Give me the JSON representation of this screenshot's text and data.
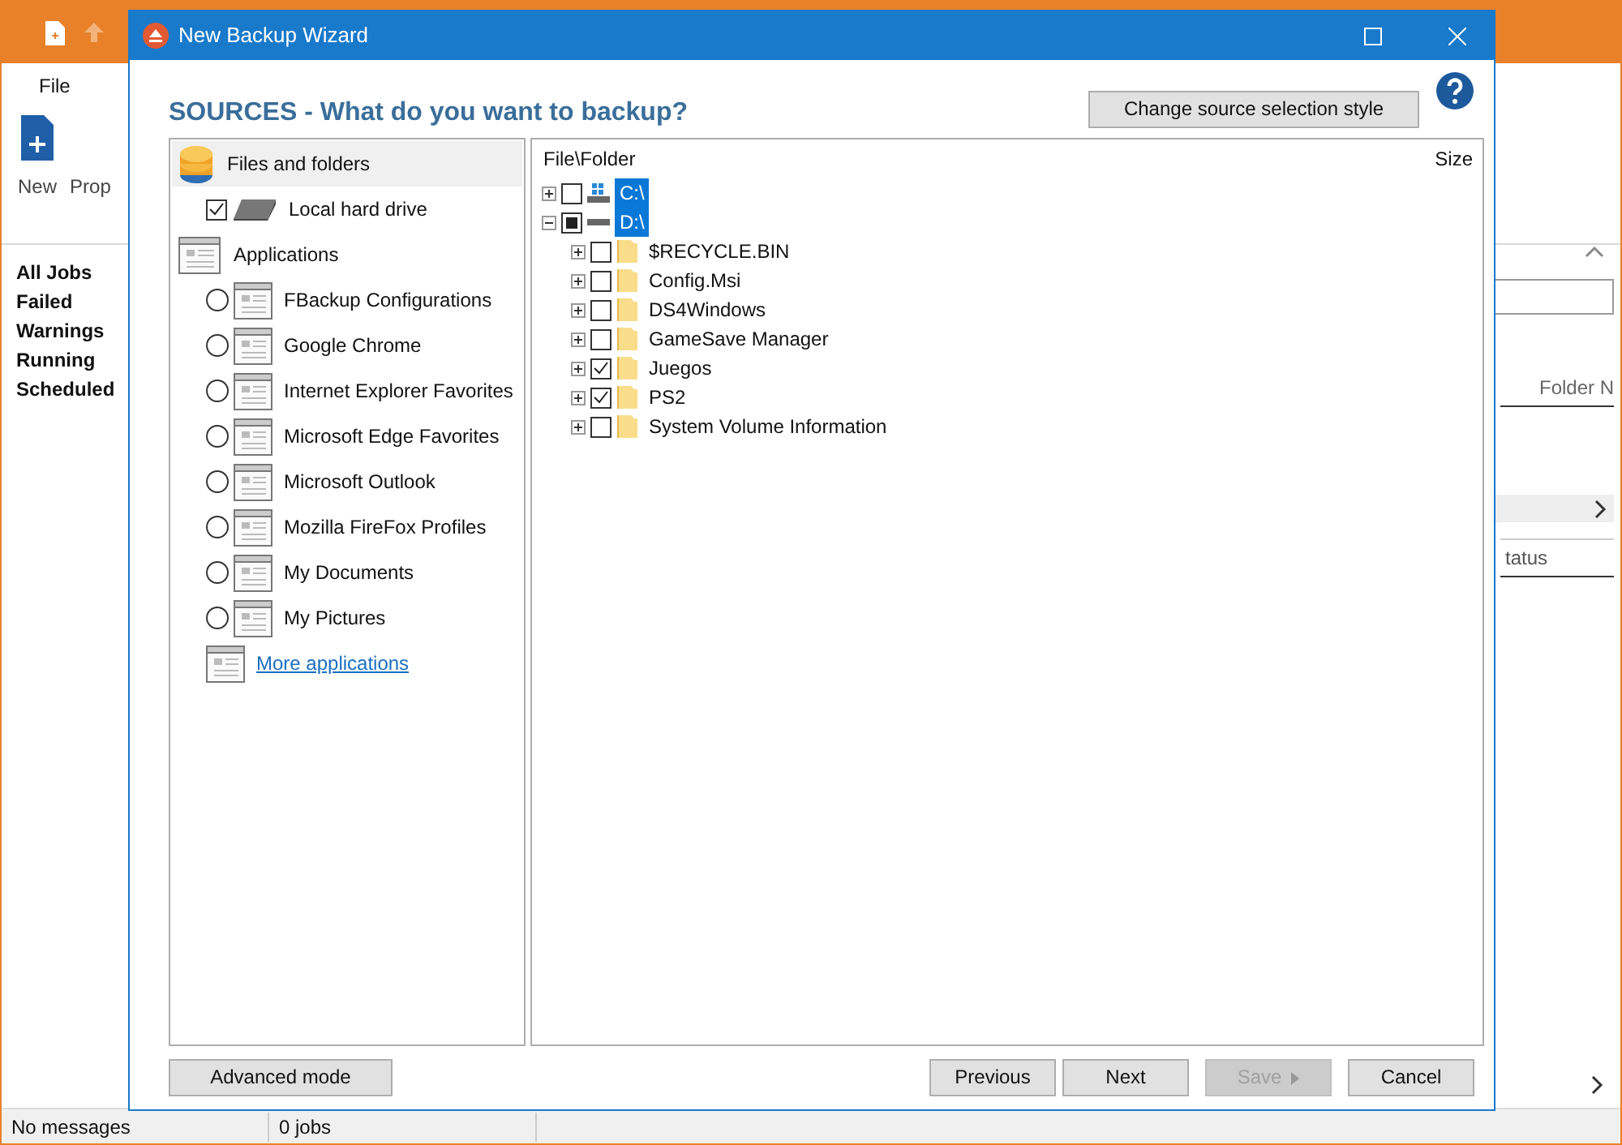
{
  "app": {
    "menu": [
      "File"
    ],
    "ribbon": [
      {
        "label": "New"
      },
      {
        "label": "Prop"
      }
    ],
    "nav": [
      "All Jobs",
      "Failed",
      "Warnings",
      "Running",
      "Scheduled"
    ],
    "column_1": "Folder N",
    "column_2": "tatus",
    "status_bar": [
      "No messages",
      "0 jobs"
    ]
  },
  "dialog": {
    "title": "New Backup Wizard",
    "heading": "SOURCES - What do you want to backup?",
    "style_button": "Change source selection style",
    "sources": [
      {
        "kind": "files",
        "label": "Files and folders",
        "selected": true,
        "children": [
          {
            "kind": "checkbox",
            "label": "Local hard drive",
            "checked": true
          }
        ]
      },
      {
        "kind": "applications",
        "label": "Applications",
        "selected": false,
        "children": [
          {
            "kind": "radio",
            "label": "FBackup Configurations",
            "checked": false
          },
          {
            "kind": "radio",
            "label": "Google Chrome",
            "checked": false
          },
          {
            "kind": "radio",
            "label": "Internet Explorer Favorites",
            "checked": false
          },
          {
            "kind": "radio",
            "label": "Microsoft Edge Favorites",
            "checked": false
          },
          {
            "kind": "radio",
            "label": "Microsoft Outlook",
            "checked": false
          },
          {
            "kind": "radio",
            "label": "Mozilla FireFox Profiles",
            "checked": false
          },
          {
            "kind": "radio",
            "label": "My Documents",
            "checked": false
          },
          {
            "kind": "radio",
            "label": "My Pictures",
            "checked": false
          },
          {
            "kind": "link",
            "label": "More applications"
          }
        ]
      }
    ],
    "tree": {
      "columns": [
        "File\\Folder",
        "Size"
      ],
      "items": [
        {
          "kind": "system-drive",
          "label": "C:\\",
          "expanded": false,
          "checked": false,
          "partial": false,
          "selected": true
        },
        {
          "kind": "drive",
          "label": "D:\\",
          "expanded": true,
          "checked": false,
          "partial": true,
          "selected": true,
          "children": [
            {
              "kind": "folder",
              "label": "$RECYCLE.BIN",
              "expanded": false,
              "checked": false,
              "partial": false,
              "selected": false
            },
            {
              "kind": "folder",
              "label": "Config.Msi",
              "expanded": false,
              "checked": false,
              "partial": false,
              "selected": false
            },
            {
              "kind": "folder",
              "label": "DS4Windows",
              "expanded": false,
              "checked": false,
              "partial": false,
              "selected": false
            },
            {
              "kind": "folder",
              "label": "GameSave Manager",
              "expanded": false,
              "checked": false,
              "partial": false,
              "selected": false
            },
            {
              "kind": "folder",
              "label": "Juegos",
              "expanded": false,
              "checked": true,
              "partial": false,
              "selected": false
            },
            {
              "kind": "folder",
              "label": "PS2",
              "expanded": false,
              "checked": true,
              "partial": false,
              "selected": false
            },
            {
              "kind": "folder",
              "label": "System Volume Information",
              "expanded": false,
              "checked": false,
              "partial": false,
              "selected": false
            }
          ]
        }
      ]
    },
    "buttons": [
      {
        "label": "Advanced mode",
        "disabled": false
      },
      {
        "label": "Previous",
        "disabled": false
      },
      {
        "label": "Next",
        "disabled": false
      },
      {
        "label": "Save",
        "disabled": true,
        "caret": true
      },
      {
        "label": "Cancel",
        "disabled": false
      }
    ]
  }
}
